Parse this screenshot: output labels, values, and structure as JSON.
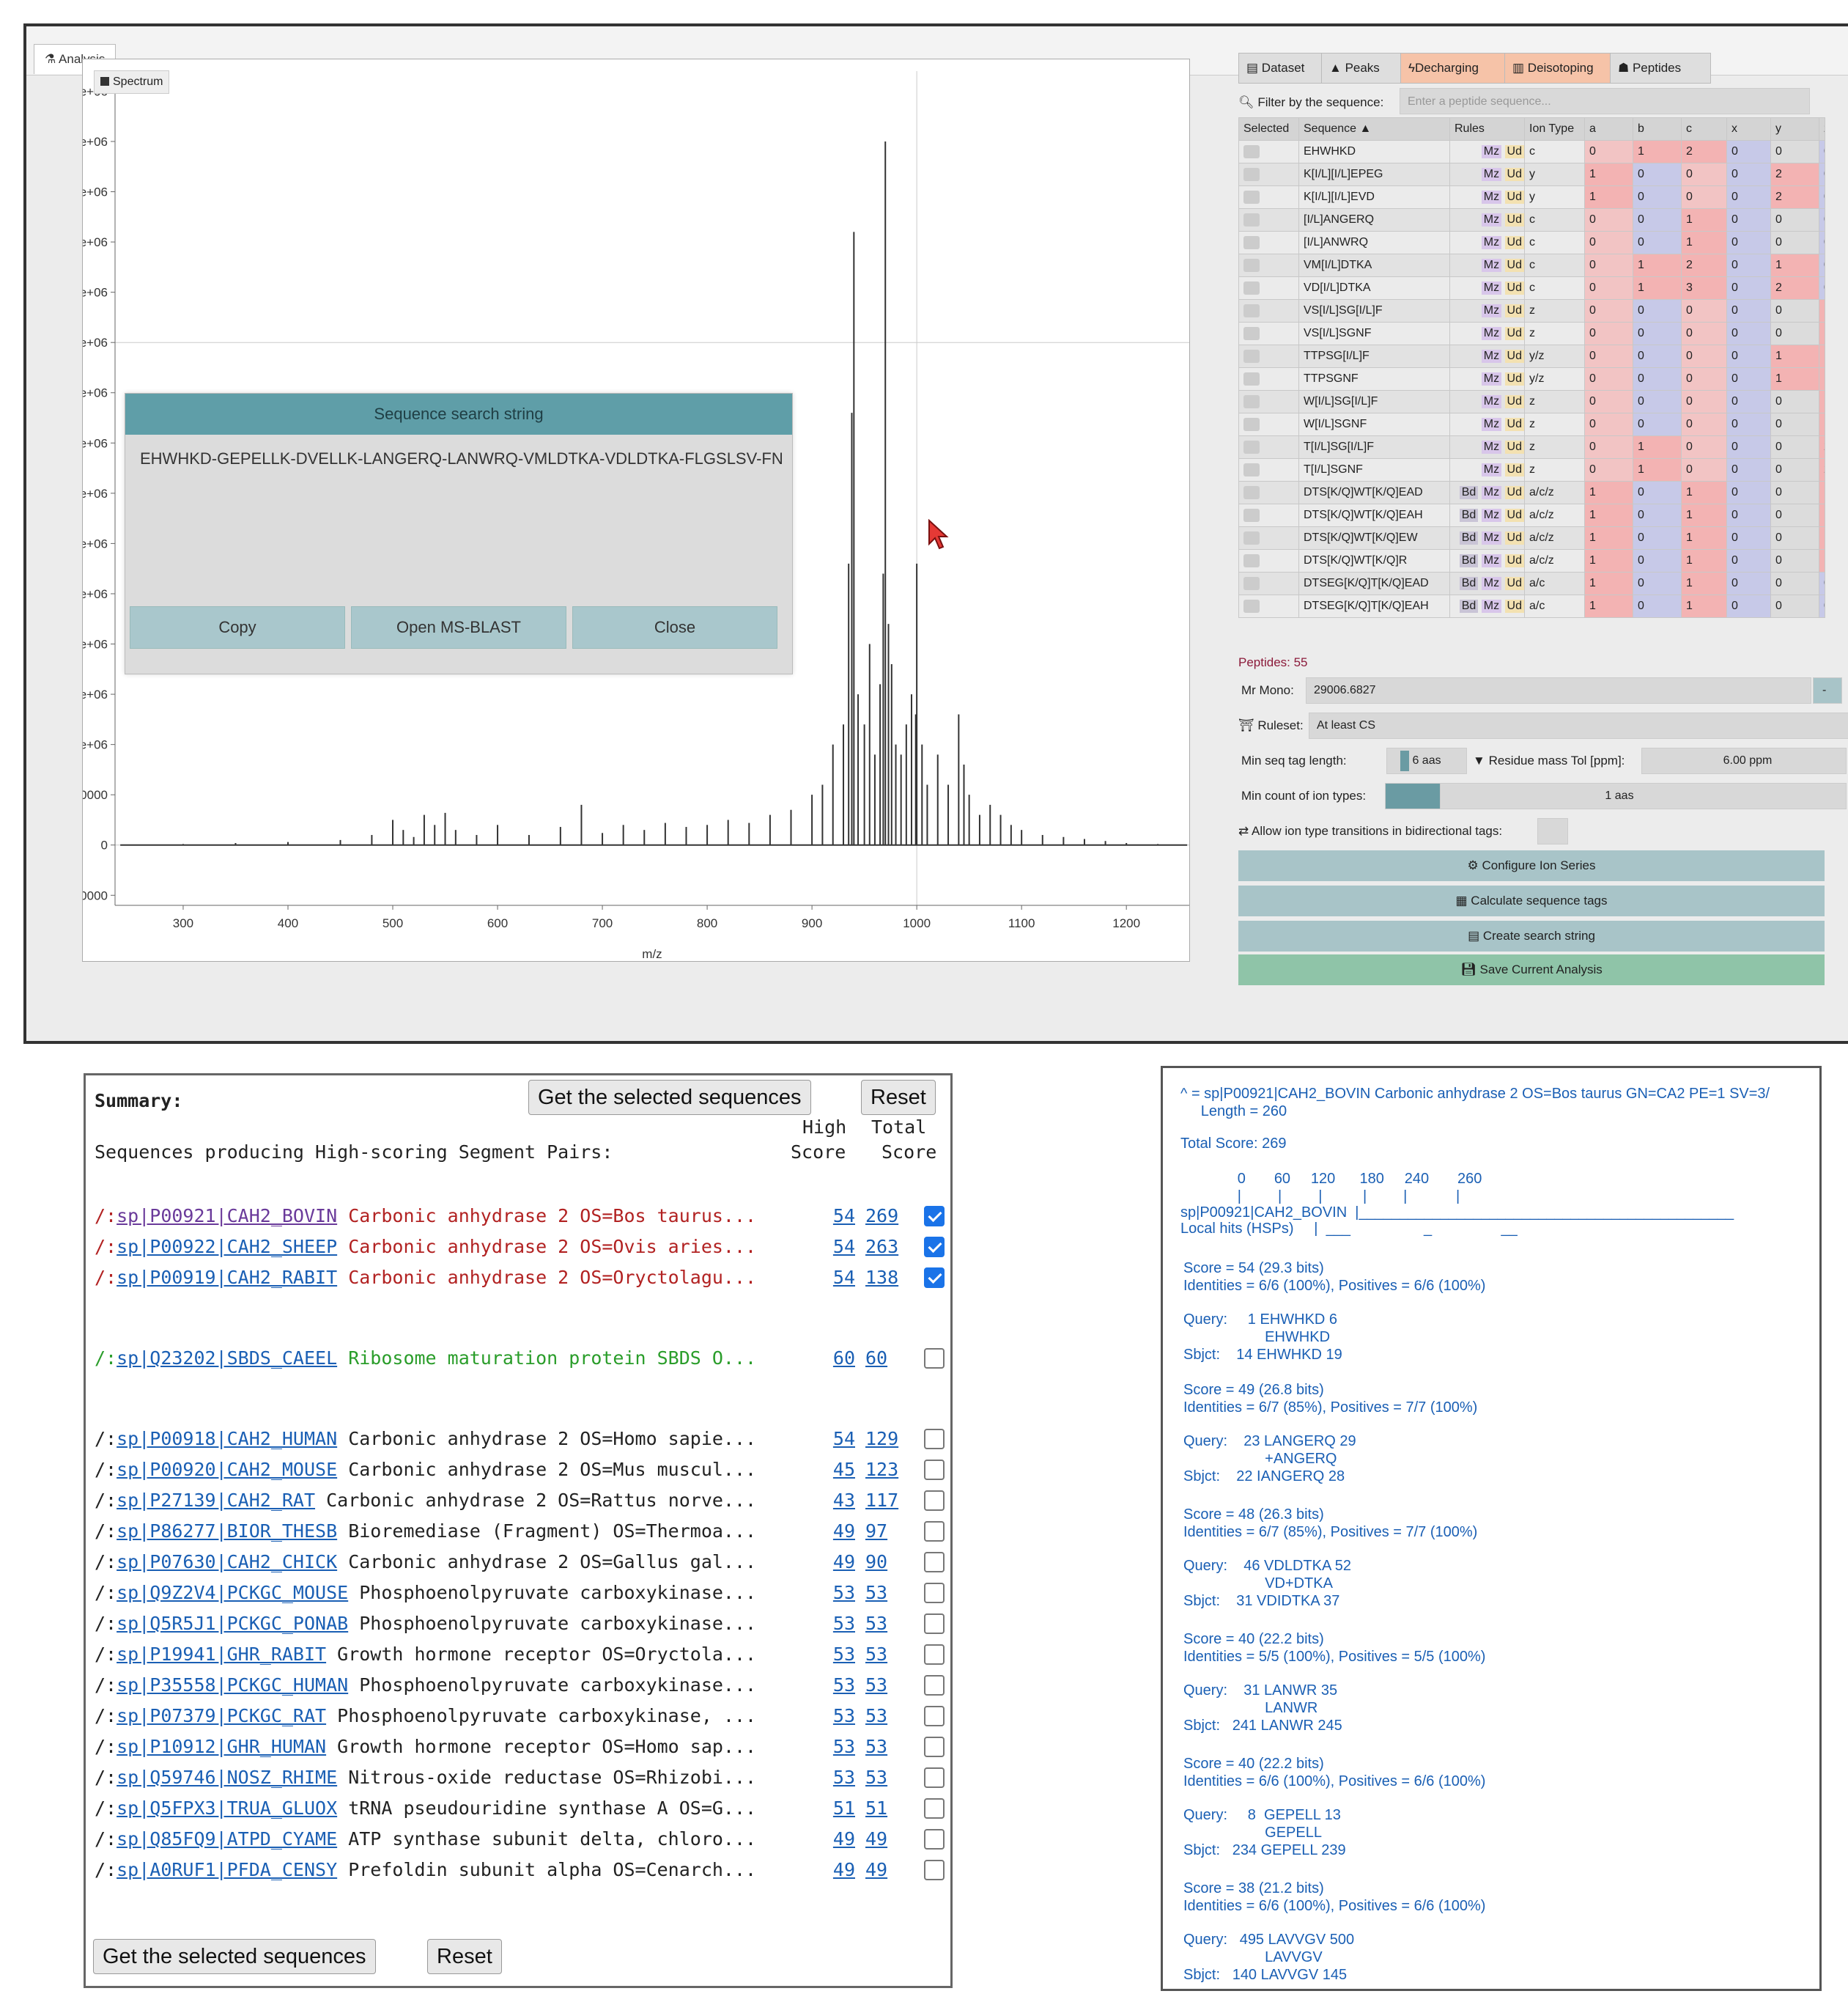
{
  "tab_analysis": "Analysis",
  "legend": "Spectrum",
  "axes": {
    "ylabel": "Intensity",
    "xlabel": "m/z",
    "yticks": [
      "7.5e+06",
      "7e+06",
      "6.5e+06",
      "6e+06",
      "5.5e+06",
      "5e+06",
      "4.5e+06",
      "4e+06",
      "3.5e+06",
      "3e+06",
      "2.5e+06",
      "2e+06",
      "1.5e+06",
      "1e+06",
      "500000",
      "0",
      "-500000"
    ],
    "xticks": [
      "300",
      "400",
      "500",
      "600",
      "700",
      "800",
      "900",
      "1000",
      "1100",
      "1200"
    ]
  },
  "chart_data": {
    "type": "line",
    "xlabel": "m/z",
    "ylabel": "Intensity",
    "xlim": [
      235,
      1260
    ],
    "ylim": [
      -600000,
      7700000
    ],
    "series": [
      {
        "name": "Spectrum",
        "x": [
          240,
          300,
          350,
          400,
          450,
          480,
          500,
          510,
          520,
          530,
          540,
          550,
          560,
          580,
          600,
          630,
          660,
          680,
          700,
          720,
          740,
          760,
          780,
          800,
          820,
          840,
          860,
          880,
          900,
          910,
          920,
          930,
          935,
          938,
          940,
          944,
          950,
          955,
          960,
          965,
          968,
          970,
          973,
          976,
          980,
          985,
          990,
          995,
          999,
          1000,
          1005,
          1010,
          1020,
          1030,
          1040,
          1045,
          1050,
          1060,
          1070,
          1080,
          1090,
          1100,
          1120,
          1140,
          1160,
          1180,
          1200,
          1230,
          1258
        ],
        "y": [
          0,
          10000,
          20000,
          30000,
          50000,
          100000,
          250000,
          150000,
          80000,
          300000,
          200000,
          320000,
          150000,
          100000,
          200000,
          100000,
          180000,
          400000,
          120000,
          200000,
          150000,
          220000,
          180000,
          200000,
          250000,
          220000,
          300000,
          350000,
          500000,
          600000,
          1000000,
          1200000,
          2800000,
          4300000,
          6100000,
          1500000,
          1200000,
          2000000,
          900000,
          1600000,
          2700000,
          7000000,
          2200000,
          1800000,
          1000000,
          900000,
          1200000,
          1500000,
          1300000,
          2800000,
          1000000,
          600000,
          900000,
          600000,
          1300000,
          800000,
          500000,
          300000,
          400000,
          300000,
          200000,
          150000,
          100000,
          80000,
          60000,
          40000,
          20000,
          10000,
          0
        ]
      }
    ]
  },
  "dialog": {
    "title": "Sequence search string",
    "text": "EHWHKD-GEPELLK-DVELLK-LANGERQ-LANWRQ-VMLDTKA-VDLDTKA-FLGSLSV-FN",
    "buttons": [
      "Copy",
      "Open MS-BLAST",
      "Close"
    ]
  },
  "right_tabs": [
    "Dataset",
    "Peaks",
    "Decharging",
    "Deisotoping",
    "Peptides"
  ],
  "filter": {
    "label": "Filter by the sequence:",
    "placeholder": "Enter a peptide sequence..."
  },
  "table": {
    "headers": [
      "Selected",
      "Sequence",
      "Rules",
      "Ion Type",
      "a",
      "b",
      "c",
      "x",
      "y",
      "z"
    ],
    "rows": [
      [
        "EHWHKD",
        "",
        "c",
        "0",
        "1",
        "2",
        "0",
        "0",
        "0"
      ],
      [
        "K[I/L][I/L]EPEG",
        "",
        "y",
        "1",
        "0",
        "0",
        "0",
        "2",
        "0"
      ],
      [
        "K[I/L][I/L]EVD",
        "",
        "y",
        "1",
        "0",
        "0",
        "0",
        "2",
        "0"
      ],
      [
        "[I/L]ANGERQ",
        "",
        "c",
        "0",
        "0",
        "1",
        "0",
        "0",
        "0"
      ],
      [
        "[I/L]ANWRQ",
        "",
        "c",
        "0",
        "0",
        "1",
        "0",
        "0",
        "0"
      ],
      [
        "VM[I/L]DTKA",
        "",
        "c",
        "0",
        "1",
        "2",
        "0",
        "1",
        "0"
      ],
      [
        "VD[I/L]DTKA",
        "",
        "c",
        "0",
        "1",
        "3",
        "0",
        "2",
        "0"
      ],
      [
        "VS[I/L]SG[I/L]F",
        "",
        "z",
        "0",
        "0",
        "0",
        "0",
        "0",
        "1"
      ],
      [
        "VS[I/L]SGNF",
        "",
        "z",
        "0",
        "0",
        "0",
        "0",
        "0",
        "1"
      ],
      [
        "TTPSG[I/L]F",
        "",
        "y/z",
        "0",
        "0",
        "0",
        "0",
        "1",
        "1"
      ],
      [
        "TTPSGNF",
        "",
        "y/z",
        "0",
        "0",
        "0",
        "0",
        "1",
        "1"
      ],
      [
        "W[I/L]SG[I/L]F",
        "",
        "z",
        "0",
        "0",
        "0",
        "0",
        "0",
        "1"
      ],
      [
        "W[I/L]SGNF",
        "",
        "z",
        "0",
        "0",
        "0",
        "0",
        "0",
        "1"
      ],
      [
        "T[I/L]SG[I/L]F",
        "",
        "z",
        "0",
        "1",
        "0",
        "0",
        "0",
        "2"
      ],
      [
        "T[I/L]SGNF",
        "",
        "z",
        "0",
        "1",
        "0",
        "0",
        "0",
        "2"
      ],
      [
        "DTS[K/Q]WT[K/Q]EAD",
        "Bd",
        "a/c/z",
        "1",
        "0",
        "1",
        "0",
        "0",
        "1"
      ],
      [
        "DTS[K/Q]WT[K/Q]EAH",
        "Bd",
        "a/c/z",
        "1",
        "0",
        "1",
        "0",
        "0",
        "1"
      ],
      [
        "DTS[K/Q]WT[K/Q]EW",
        "Bd",
        "a/c/z",
        "1",
        "0",
        "1",
        "0",
        "0",
        "1"
      ],
      [
        "DTS[K/Q]WT[K/Q]R",
        "Bd",
        "a/c/z",
        "1",
        "0",
        "1",
        "0",
        "0",
        "1"
      ],
      [
        "DTSEG[K/Q]T[K/Q]EAD",
        "Bd",
        "a/c",
        "1",
        "0",
        "1",
        "0",
        "0",
        "0"
      ],
      [
        "DTSEG[K/Q]T[K/Q]EAH",
        "Bd",
        "a/c",
        "1",
        "0",
        "1",
        "0",
        "0",
        "0"
      ]
    ]
  },
  "peptides": "Peptides: 55",
  "mr_mono": {
    "label": "Mr Mono:",
    "value": "29006.6827",
    "btn": "-"
  },
  "ruleset": {
    "label": "Ruleset:",
    "value": "At least CS"
  },
  "minseq": {
    "label": "Min seq tag length:",
    "value": "6 aas"
  },
  "residue": {
    "label": "Residue mass Tol [ppm]:",
    "value": "6.00 ppm"
  },
  "mincount": {
    "label": "Min count of ion types:",
    "value": "1 aas"
  },
  "allow": {
    "label": "Allow ion type transitions in bidirectional tags:"
  },
  "buttons": [
    "Configure Ion Series",
    "Calculate sequence tags",
    "Create search string",
    "Save Current Analysis"
  ],
  "blast": {
    "summary": "Summary:",
    "get_btn": "Get the selected sequences",
    "reset_btn": "Reset",
    "high": "High",
    "score": "Score",
    "total": "Total",
    "score2": "Score",
    "producing": "Sequences producing High-scoring Segment Pairs:",
    "hits": [
      {
        "pre": "/:",
        "id": "sp|P00921|CAH2_BOVIN",
        "desc": " Carbonic anhydrase 2 OS=Bos taurus...",
        "high": "54",
        "total": "269",
        "checked": true,
        "color": "red"
      },
      {
        "pre": "/:",
        "id": "sp|P00922|CAH2_SHEEP",
        "desc": " Carbonic anhydrase 2 OS=Ovis aries...",
        "high": "54",
        "total": "263",
        "checked": true,
        "color": "red"
      },
      {
        "pre": "/:",
        "id": "sp|P00919|CAH2_RABIT",
        "desc": " Carbonic anhydrase 2 OS=Oryctolagu...",
        "high": "54",
        "total": "138",
        "checked": true,
        "color": "red"
      },
      {
        "pre": "/:",
        "id": "sp|Q23202|SBDS_CAEEL",
        "desc": " Ribosome maturation protein SBDS O...",
        "high": "60",
        "total": "60",
        "checked": false,
        "color": "green"
      },
      {
        "pre": "/:",
        "id": "sp|P00918|CAH2_HUMAN",
        "desc": " Carbonic anhydrase 2 OS=Homo sapie...",
        "high": "54",
        "total": "129",
        "checked": false,
        "color": ""
      },
      {
        "pre": "/:",
        "id": "sp|P00920|CAH2_MOUSE",
        "desc": " Carbonic anhydrase 2 OS=Mus muscul...",
        "high": "45",
        "total": "123",
        "checked": false,
        "color": ""
      },
      {
        "pre": "/:",
        "id": "sp|P27139|CAH2_RAT",
        "desc": " Carbonic anhydrase 2 OS=Rattus norve...",
        "high": "43",
        "total": "117",
        "checked": false,
        "color": ""
      },
      {
        "pre": "/:",
        "id": "sp|P86277|BIOR_THESB",
        "desc": " Bioremediase (Fragment) OS=Thermoa...",
        "high": "49",
        "total": "97",
        "checked": false,
        "color": ""
      },
      {
        "pre": "/:",
        "id": "sp|P07630|CAH2_CHICK",
        "desc": " Carbonic anhydrase 2 OS=Gallus gal...",
        "high": "49",
        "total": "90",
        "checked": false,
        "color": ""
      },
      {
        "pre": "/:",
        "id": "sp|Q9Z2V4|PCKGC_MOUSE",
        "desc": " Phosphoenolpyruvate carboxykinase...",
        "high": "53",
        "total": "53",
        "checked": false,
        "color": ""
      },
      {
        "pre": "/:",
        "id": "sp|Q5R5J1|PCKGC_PONAB",
        "desc": " Phosphoenolpyruvate carboxykinase...",
        "high": "53",
        "total": "53",
        "checked": false,
        "color": ""
      },
      {
        "pre": "/:",
        "id": "sp|P19941|GHR_RABIT",
        "desc": " Growth hormone receptor OS=Oryctola...",
        "high": "53",
        "total": "53",
        "checked": false,
        "color": ""
      },
      {
        "pre": "/:",
        "id": "sp|P35558|PCKGC_HUMAN",
        "desc": " Phosphoenolpyruvate carboxykinase...",
        "high": "53",
        "total": "53",
        "checked": false,
        "color": ""
      },
      {
        "pre": "/:",
        "id": "sp|P07379|PCKGC_RAT",
        "desc": " Phosphoenolpyruvate carboxykinase, ...",
        "high": "53",
        "total": "53",
        "checked": false,
        "color": ""
      },
      {
        "pre": "/:",
        "id": "sp|P10912|GHR_HUMAN",
        "desc": " Growth hormone receptor OS=Homo sap...",
        "high": "53",
        "total": "53",
        "checked": false,
        "color": ""
      },
      {
        "pre": "/:",
        "id": "sp|Q59746|NOSZ_RHIME",
        "desc": " Nitrous-oxide reductase OS=Rhizobi...",
        "high": "53",
        "total": "53",
        "checked": false,
        "color": ""
      },
      {
        "pre": "/:",
        "id": "sp|Q5FPX3|TRUA_GLUOX",
        "desc": " tRNA pseudouridine synthase A OS=G...",
        "high": "51",
        "total": "51",
        "checked": false,
        "color": ""
      },
      {
        "pre": "/:",
        "id": "sp|Q85FQ9|ATPD_CYAME",
        "desc": " ATP synthase subunit delta, chloro...",
        "high": "49",
        "total": "49",
        "checked": false,
        "color": ""
      },
      {
        "pre": "/:",
        "id": "sp|A0RUF1|PFDA_CENSY",
        "desc": " Prefoldin subunit alpha OS=Cenarch...",
        "high": "49",
        "total": "49",
        "checked": false,
        "color": ""
      }
    ],
    "bottom_get": "Get the selected sequences",
    "bottom_reset": "Reset"
  },
  "detail": {
    "lines": [
      "^ = sp|P00921|CAH2_BOVIN Carbonic anhydrase 2 OS=Bos taurus GN=CA2 PE=1 SV=3/",
      "     Length = 260",
      "Total Score: 269",
      "              0       60     120      180     240       260",
      "              |         |         |          |         |            |",
      "sp|P00921|CAH2_BOVIN  |______________________________________________",
      "Local hits (HSPs)     |  ___                  _                 __",
      "Score = 54 (29.3 bits)",
      "Identities = 6/6 (100%), Positives = 6/6 (100%)",
      "Query:     1 EHWHKD 6",
      "                    EHWHKD",
      "Sbjct:    14 EHWHKD 19",
      "Score = 49 (26.8 bits)",
      "Identities = 6/7 (85%), Positives = 7/7 (100%)",
      "Query:    23 LANGERQ 29",
      "                    +ANGERQ",
      "Sbjct:    22 IANGERQ 28",
      "Score = 48 (26.3 bits)",
      "Identities = 6/7 (85%), Positives = 7/7 (100%)",
      "Query:    46 VDLDTKA 52",
      "                    VD+DTKA",
      "Sbjct:    31 VDIDTKA 37",
      "Score = 40 (22.2 bits)",
      "Identities = 5/5 (100%), Positives = 5/5 (100%)",
      "Query:    31 LANWR 35",
      "                    LANWR",
      "Sbjct:   241 LANWR 245",
      "Score = 40 (22.2 bits)",
      "Identities = 6/6 (100%), Positives = 6/6 (100%)",
      "Query:     8  GEPELL 13",
      "                    GEPELL",
      "Sbjct:   234 GEPELL 239",
      "Score = 38 (21.2 bits)",
      "Identities = 6/6 (100%), Positives = 6/6 (100%)",
      "Query:   495 LAVVGV 500",
      "                    LAVVGV",
      "Sbjct:   140 LAVVGV 145"
    ]
  }
}
